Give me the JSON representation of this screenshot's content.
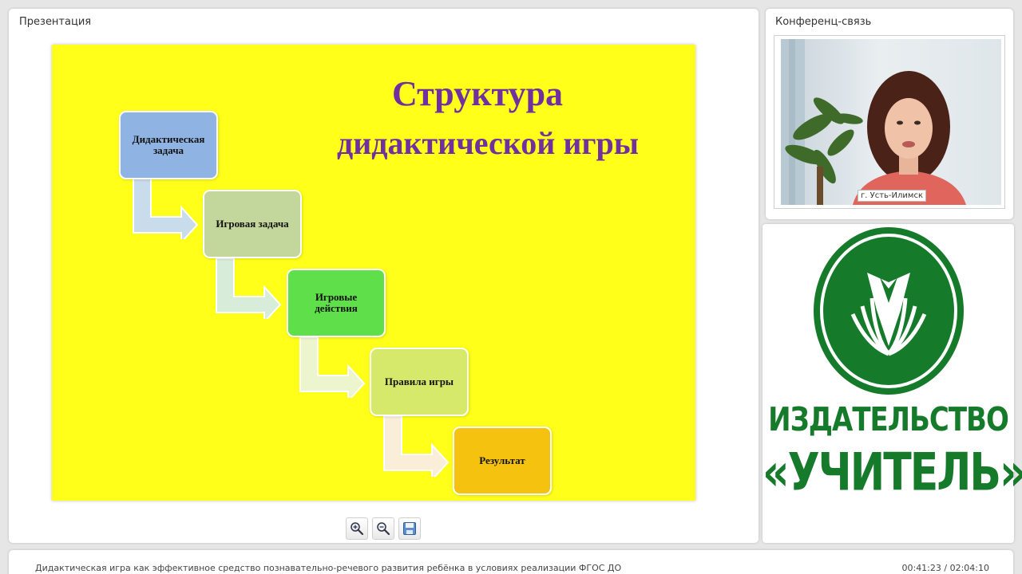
{
  "presentation": {
    "title": "Презентация",
    "slide": {
      "title_line1": "Структура",
      "title_line2": "дидактической игры",
      "steps": [
        {
          "label": "Дидактическая задача",
          "color": "#8fb4e3"
        },
        {
          "label": "Игровая задача",
          "color": "#c3d69b"
        },
        {
          "label": "Игровые действия",
          "color": "#5fe04a"
        },
        {
          "label": "Правила игры",
          "color": "#d7e96a"
        },
        {
          "label": "Результат",
          "color": "#f5c20f"
        }
      ],
      "background_color": "#ffff1a",
      "title_color": "#7030a0"
    },
    "toolbar": {
      "zoom_in_icon": "zoom-in-icon",
      "zoom_out_icon": "zoom-out-icon",
      "save_icon": "save-icon"
    }
  },
  "conference": {
    "title": "Конференц-связь",
    "location_label": "г. Усть-Илимск"
  },
  "logo": {
    "line1": "ИЗДАТЕЛЬСТВО",
    "line2": "«УЧИТЕЛЬ»",
    "color": "#167a2b"
  },
  "footer": {
    "description": "Дидактическая игра как эффективное средство познавательно-речевого развития ребёнка в условиях реализации ФГОС ДО",
    "time": "00:41:23 / 02:04:10"
  }
}
